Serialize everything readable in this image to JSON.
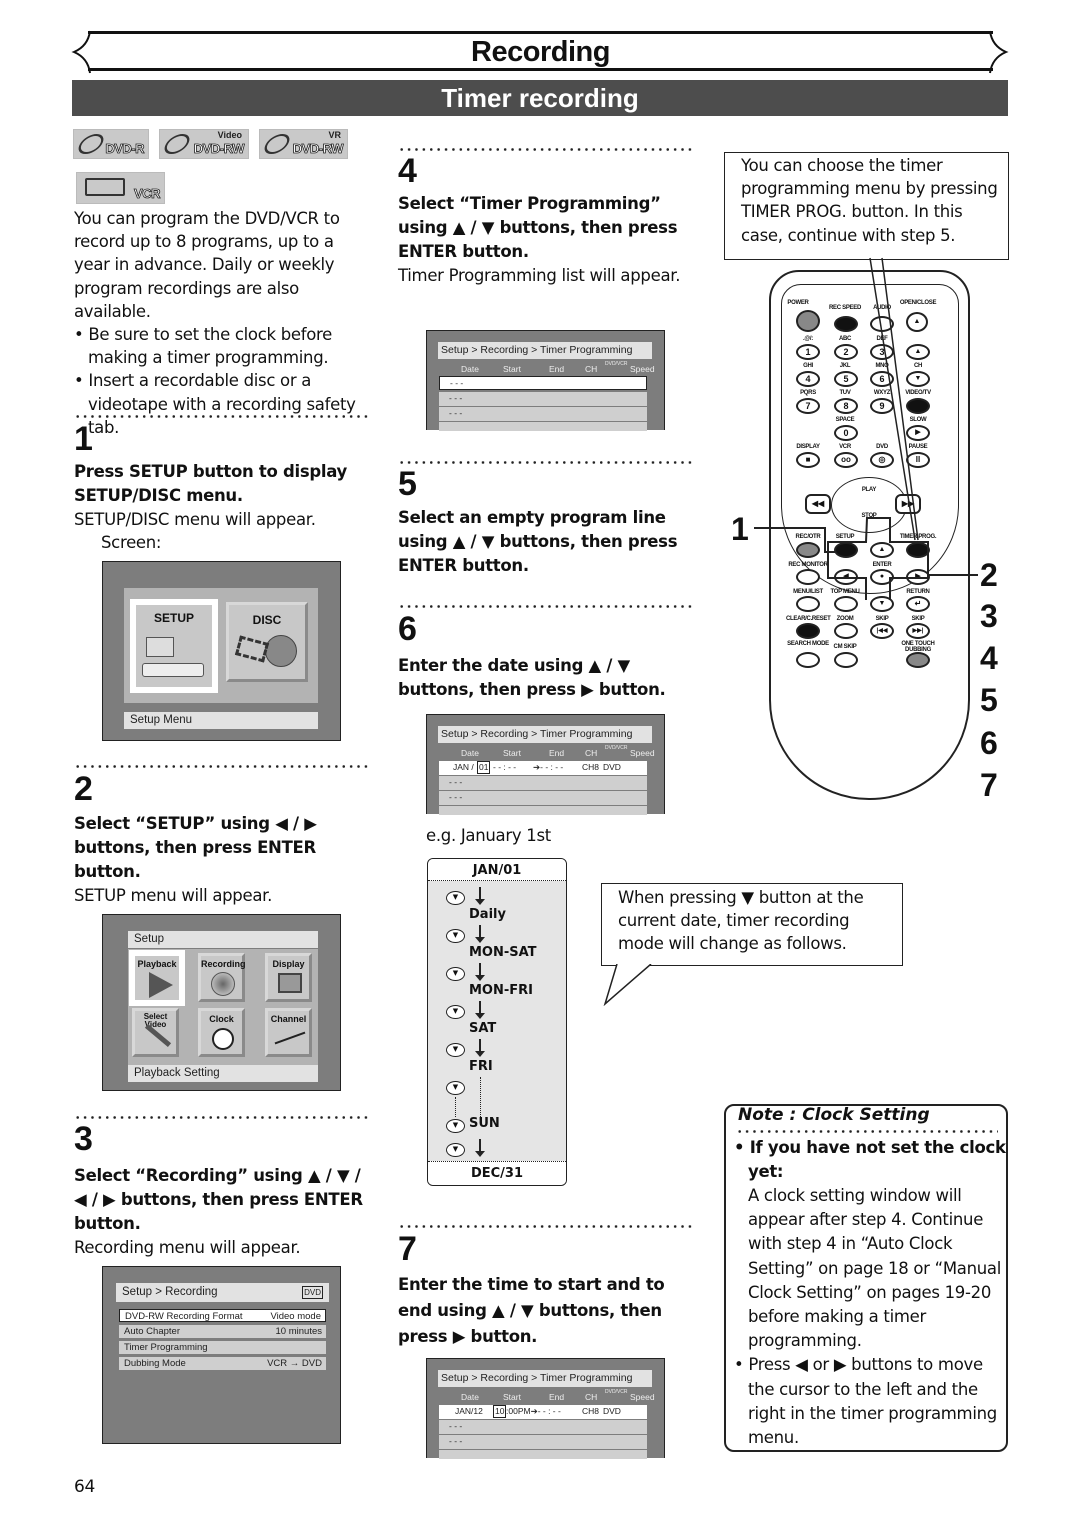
{
  "header": {
    "title": "Recording",
    "subtitle": "Timer recording"
  },
  "badges": [
    {
      "label": "DVD-R",
      "sup": ""
    },
    {
      "label": "DVD-RW",
      "sup": "Video"
    },
    {
      "label": "DVD-RW",
      "sup": "VR"
    },
    {
      "label": "VCR",
      "sup": ""
    }
  ],
  "intro": {
    "text": "You can program the DVD/VCR to record up to 8 programs, up to a year in advance. Daily or weekly program recordings are also available.",
    "bullets": [
      "Be sure to set the clock before making a timer programming.",
      "Insert a recordable disc or a videotape with a recording safety tab."
    ]
  },
  "steps": [
    {
      "num": "1",
      "instruction": "Press SETUP button to display SETUP/DISC menu.",
      "result": "SETUP/DISC menu will appear.",
      "extra": "Screen:"
    },
    {
      "num": "2",
      "instruction": "Select “SETUP” using ◀ / ▶ buttons, then press ENTER button.",
      "result": "SETUP menu will appear."
    },
    {
      "num": "3",
      "instruction": "Select “Recording” using ▲ / ▼ / ◀ / ▶ buttons, then press ENTER button.",
      "result": "Recording menu will appear."
    },
    {
      "num": "4",
      "instruction": "Select “Timer Programming” using ▲ / ▼ buttons, then press ENTER button.",
      "result": "Timer Programming list will appear."
    },
    {
      "num": "5",
      "instruction": "Select an empty program line using ▲ / ▼ buttons, then press ENTER button."
    },
    {
      "num": "6",
      "instruction": "Enter the date using ▲ / ▼ buttons, then press ▶ button.",
      "example": "e.g. January 1st"
    },
    {
      "num": "7",
      "instruction": "Enter the time to start and to end using ▲ / ▼ buttons, then press ▶ button."
    }
  ],
  "screen1": {
    "tiles": [
      "SETUP",
      "DISC"
    ],
    "footer": "Setup Menu"
  },
  "screen2": {
    "title": "Setup",
    "tiles": [
      "Playback",
      "Recording",
      "Display",
      "Select Video",
      "Clock",
      "Channel"
    ],
    "footer": "Playback Setting"
  },
  "screen3": {
    "title": "Setup > Recording",
    "tag": "DVD",
    "rows": [
      {
        "label": "DVD-RW Recording Format",
        "value": "Video mode"
      },
      {
        "label": "Auto Chapter",
        "value": "10 minutes"
      },
      {
        "label": "Timer Programming",
        "value": ""
      },
      {
        "label": "Dubbing Mode",
        "value": "VCR → DVD"
      }
    ]
  },
  "timer_screen": {
    "title": "Setup > Recording > Timer Programming",
    "columns": [
      "Date",
      "Start",
      "End",
      "CH",
      "DVD/VCR",
      "Speed"
    ],
    "empty": "- - -"
  },
  "screen6_row": {
    "date_prefix": "JAN /",
    "date_sel": "01",
    "start": "- - : - -",
    "end": "➔- - : - -",
    "ch": "CH8",
    "media": "DVD"
  },
  "screen7_row": {
    "date": "JAN/12",
    "start_sel": "10",
    "start_rest": ":00PM➔- - : - -",
    "ch": "CH8",
    "media": "DVD"
  },
  "mode_chart": {
    "start": "JAN/01",
    "modes": [
      "Daily",
      "MON-SAT",
      "MON-FRI",
      "SAT",
      "FRI",
      "SUN"
    ],
    "end": "DEC/31"
  },
  "callout_mode": "When pressing ▼ button at the current date, timer recording mode will change as follows.",
  "callout_timer": "You can choose the timer programming menu by pressing TIMER PROG. button. In this case, continue with step 5.",
  "note": {
    "title": "Note : Clock Setting",
    "bullet1_bold": "If you have not set the clock yet:",
    "bullet1_text": "A clock setting window will appear after step 4. Continue with step 4 in “Auto Clock Setting” on page 18 or “Manual Clock Setting” on pages 19-20 before making a timer programming.",
    "bullet2": "Press ◀ or ▶ buttons to move the cursor to the left and the right in the timer programming menu."
  },
  "remote": {
    "labels": [
      "POWER",
      "REC SPEED",
      "AUDIO",
      "OPEN/CLOSE",
      ".@/:",
      "ABC",
      "DEF",
      "GHI",
      "JKL",
      "MNO",
      "CH",
      "PQRS",
      "TUV",
      "WXYZ",
      "VIDEO/TV",
      "SPACE",
      "SLOW",
      "DISPLAY",
      "VCR",
      "DVD",
      "PAUSE",
      "PLAY",
      "STOP",
      "REC/OTR",
      "SETUP",
      "TIMER PROG.",
      "REC MONITOR",
      "ENTER",
      "MENU/LIST",
      "TOP MENU",
      "RETURN",
      "CLEAR/C.RESET",
      "ZOOM",
      "SKIP",
      "SKIP",
      "SEARCH MODE",
      "CM SKIP",
      "ONE TOUCH DUBBING"
    ],
    "digits": [
      "1",
      "2",
      "3",
      "4",
      "5",
      "6",
      "7",
      "8",
      "9",
      "0"
    ],
    "step_markers_left": "1",
    "step_markers_right": [
      "2",
      "3",
      "4",
      "5",
      "6",
      "7"
    ]
  },
  "page_number": "64"
}
